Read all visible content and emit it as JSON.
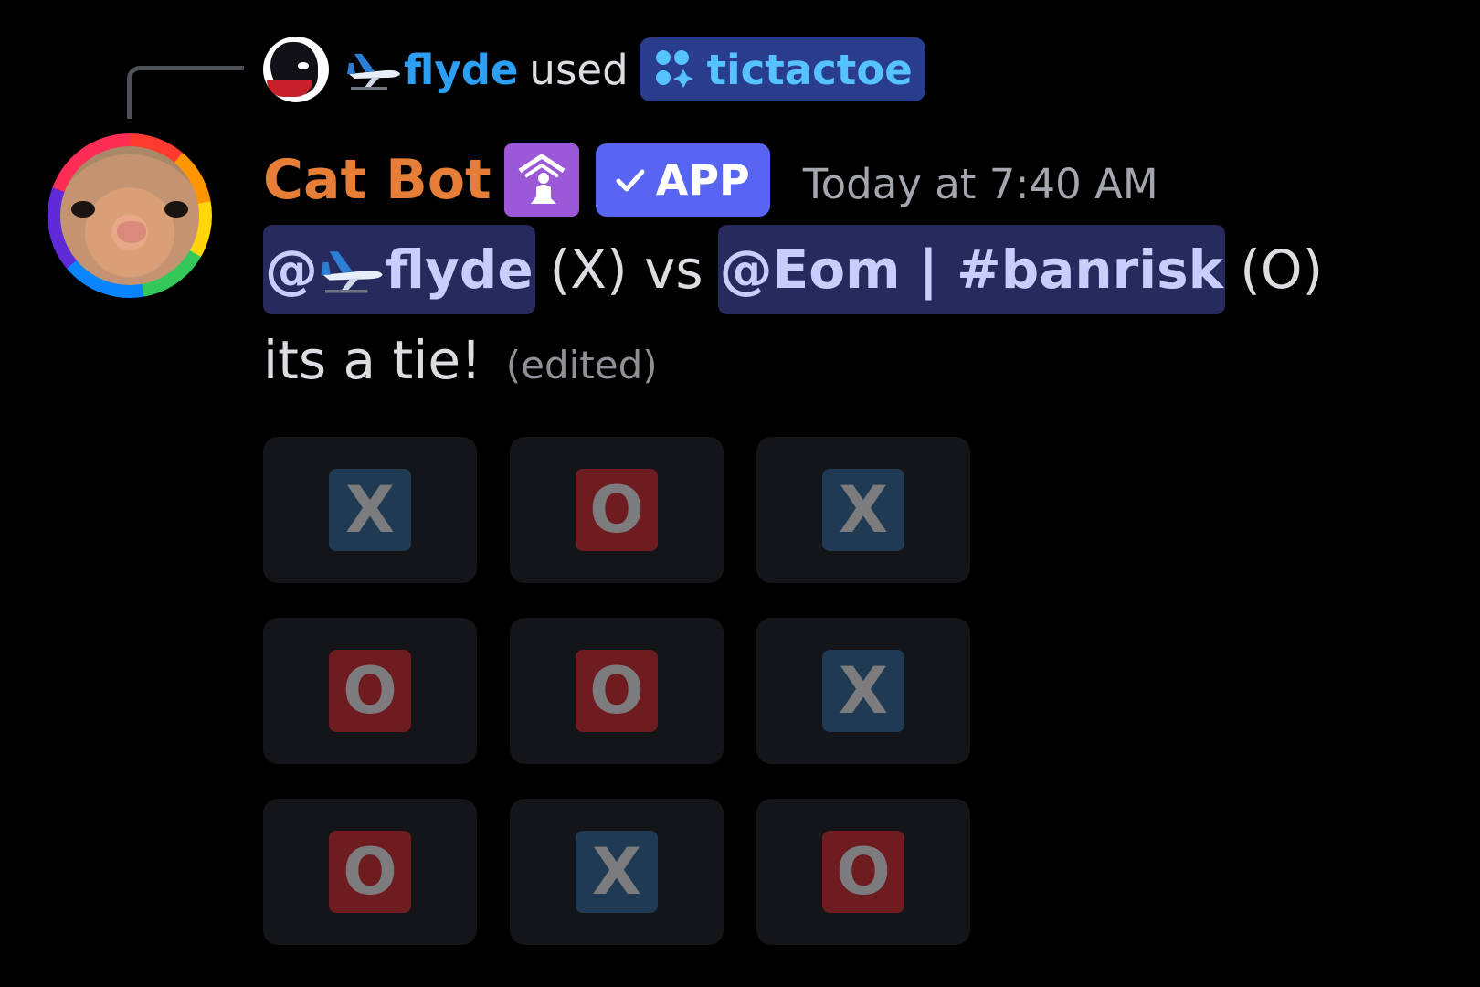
{
  "interaction": {
    "user_name": "flyde",
    "action": "used",
    "command": "tictactoe"
  },
  "message": {
    "author": "Cat Bot",
    "app_tag": "APP",
    "timestamp": "Today at 7:40 AM",
    "mention_player_x": "@",
    "mention_player_x_name": "flyde",
    "player_x_suffix": "(X) vs",
    "mention_player_o": "@Eom | #banrisk",
    "player_o_suffix": "(O)",
    "result_text": "its a tie!",
    "edited_label": "(edited)"
  },
  "board": [
    [
      "X",
      "O",
      "X"
    ],
    [
      "O",
      "O",
      "X"
    ],
    [
      "O",
      "X",
      "O"
    ]
  ],
  "colors": {
    "accent": "#5865f2",
    "author": "#e67e37",
    "interaction_user": "#2c9ff5",
    "x_mark_bg": "#1f3a52",
    "o_mark_bg": "#6f1c20"
  },
  "icons": {
    "mini_avatar": "bird-avatar-icon",
    "plane": "airplane-icon",
    "command": "app-command-icon",
    "role": "praying-role-icon",
    "verified": "checkmark-icon"
  }
}
